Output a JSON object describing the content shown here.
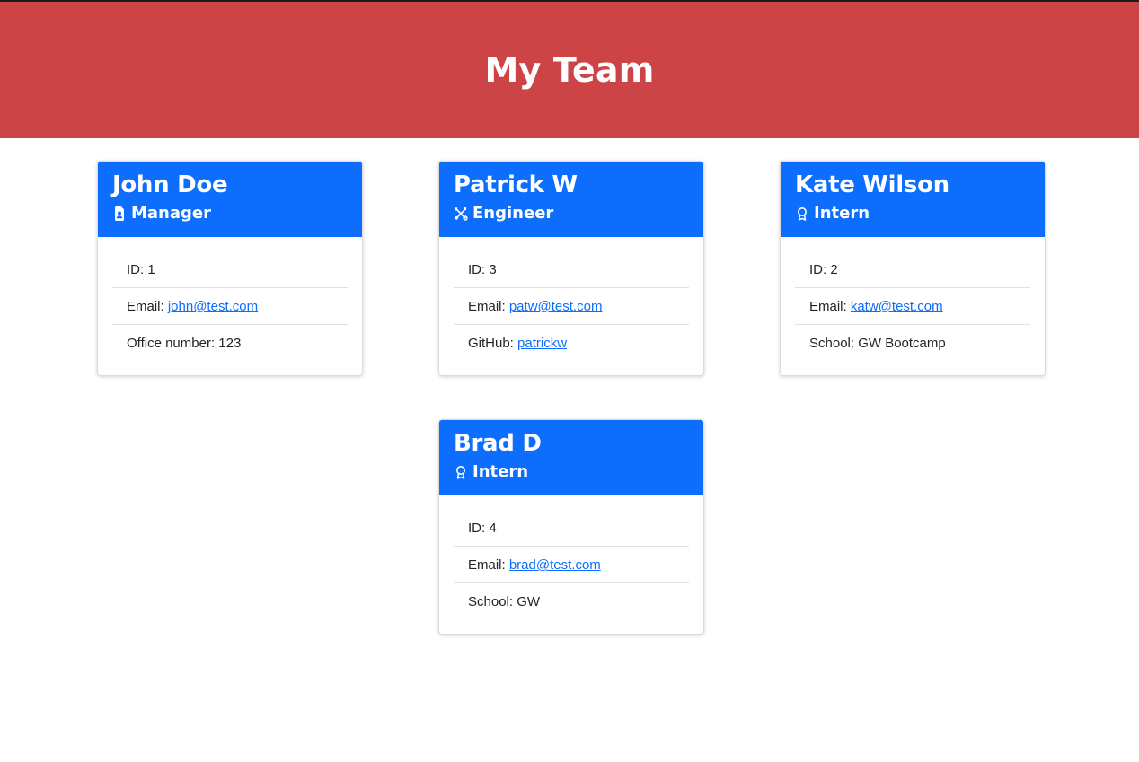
{
  "header": {
    "title": "My Team"
  },
  "employees": [
    {
      "name": "John Doe",
      "role": "Manager",
      "role_icon": "id-badge-icon",
      "id_label": "ID: 1",
      "email_label": "Email: ",
      "email": "john@test.com",
      "extra_label": "Office number: 123",
      "extra_link": ""
    },
    {
      "name": "Patrick W",
      "role": "Engineer",
      "role_icon": "tools-icon",
      "id_label": "ID: 3",
      "email_label": "Email: ",
      "email": "patw@test.com",
      "extra_label": "GitHub: ",
      "extra_link": "patrickw"
    },
    {
      "name": "Kate Wilson",
      "role": "Intern",
      "role_icon": "award-icon",
      "id_label": "ID: 2",
      "email_label": "Email: ",
      "email": "katw@test.com",
      "extra_label": "School: GW Bootcamp",
      "extra_link": ""
    },
    {
      "name": "Brad D",
      "role": "Intern",
      "role_icon": "award-icon",
      "id_label": "ID: 4",
      "email_label": "Email: ",
      "email": "brad@test.com",
      "extra_label": "School: GW",
      "extra_link": ""
    }
  ],
  "colors": {
    "header_bg": "#cc4446",
    "card_header_bg": "#0d6efd",
    "link": "#0d6efd"
  }
}
